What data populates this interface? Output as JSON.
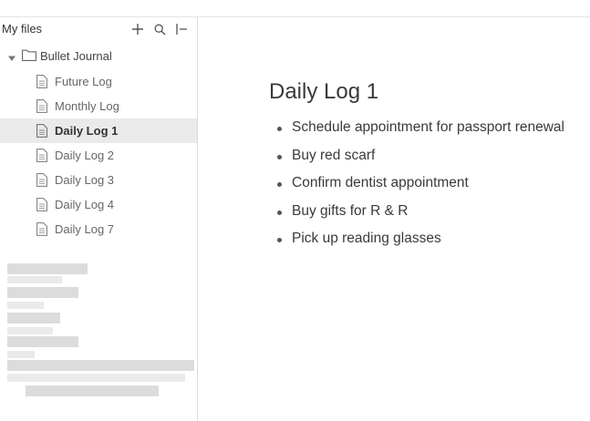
{
  "sidebar": {
    "title": "My files",
    "icons": [
      "plus-icon",
      "search-icon",
      "collapse-sidebar-icon"
    ],
    "folder": {
      "label": "Bullet Journal",
      "expanded": true
    },
    "files": [
      {
        "label": "Future Log",
        "active": false
      },
      {
        "label": "Monthly Log",
        "active": false
      },
      {
        "label": "Daily Log 1",
        "active": true
      },
      {
        "label": "Daily Log 2",
        "active": false
      },
      {
        "label": "Daily Log 3",
        "active": false
      },
      {
        "label": "Daily Log 4",
        "active": false
      },
      {
        "label": "Daily Log 7",
        "active": false
      }
    ]
  },
  "document": {
    "title": "Daily Log 1",
    "items": [
      "Schedule appointment for passport renewal",
      "Buy red scarf",
      "Confirm dentist appointment",
      "Buy gifts for R & R",
      "Pick up reading glasses"
    ]
  },
  "colors": {
    "active_row": "#eaeaea",
    "text": "#3a3a3a",
    "muted_text": "#666666"
  }
}
